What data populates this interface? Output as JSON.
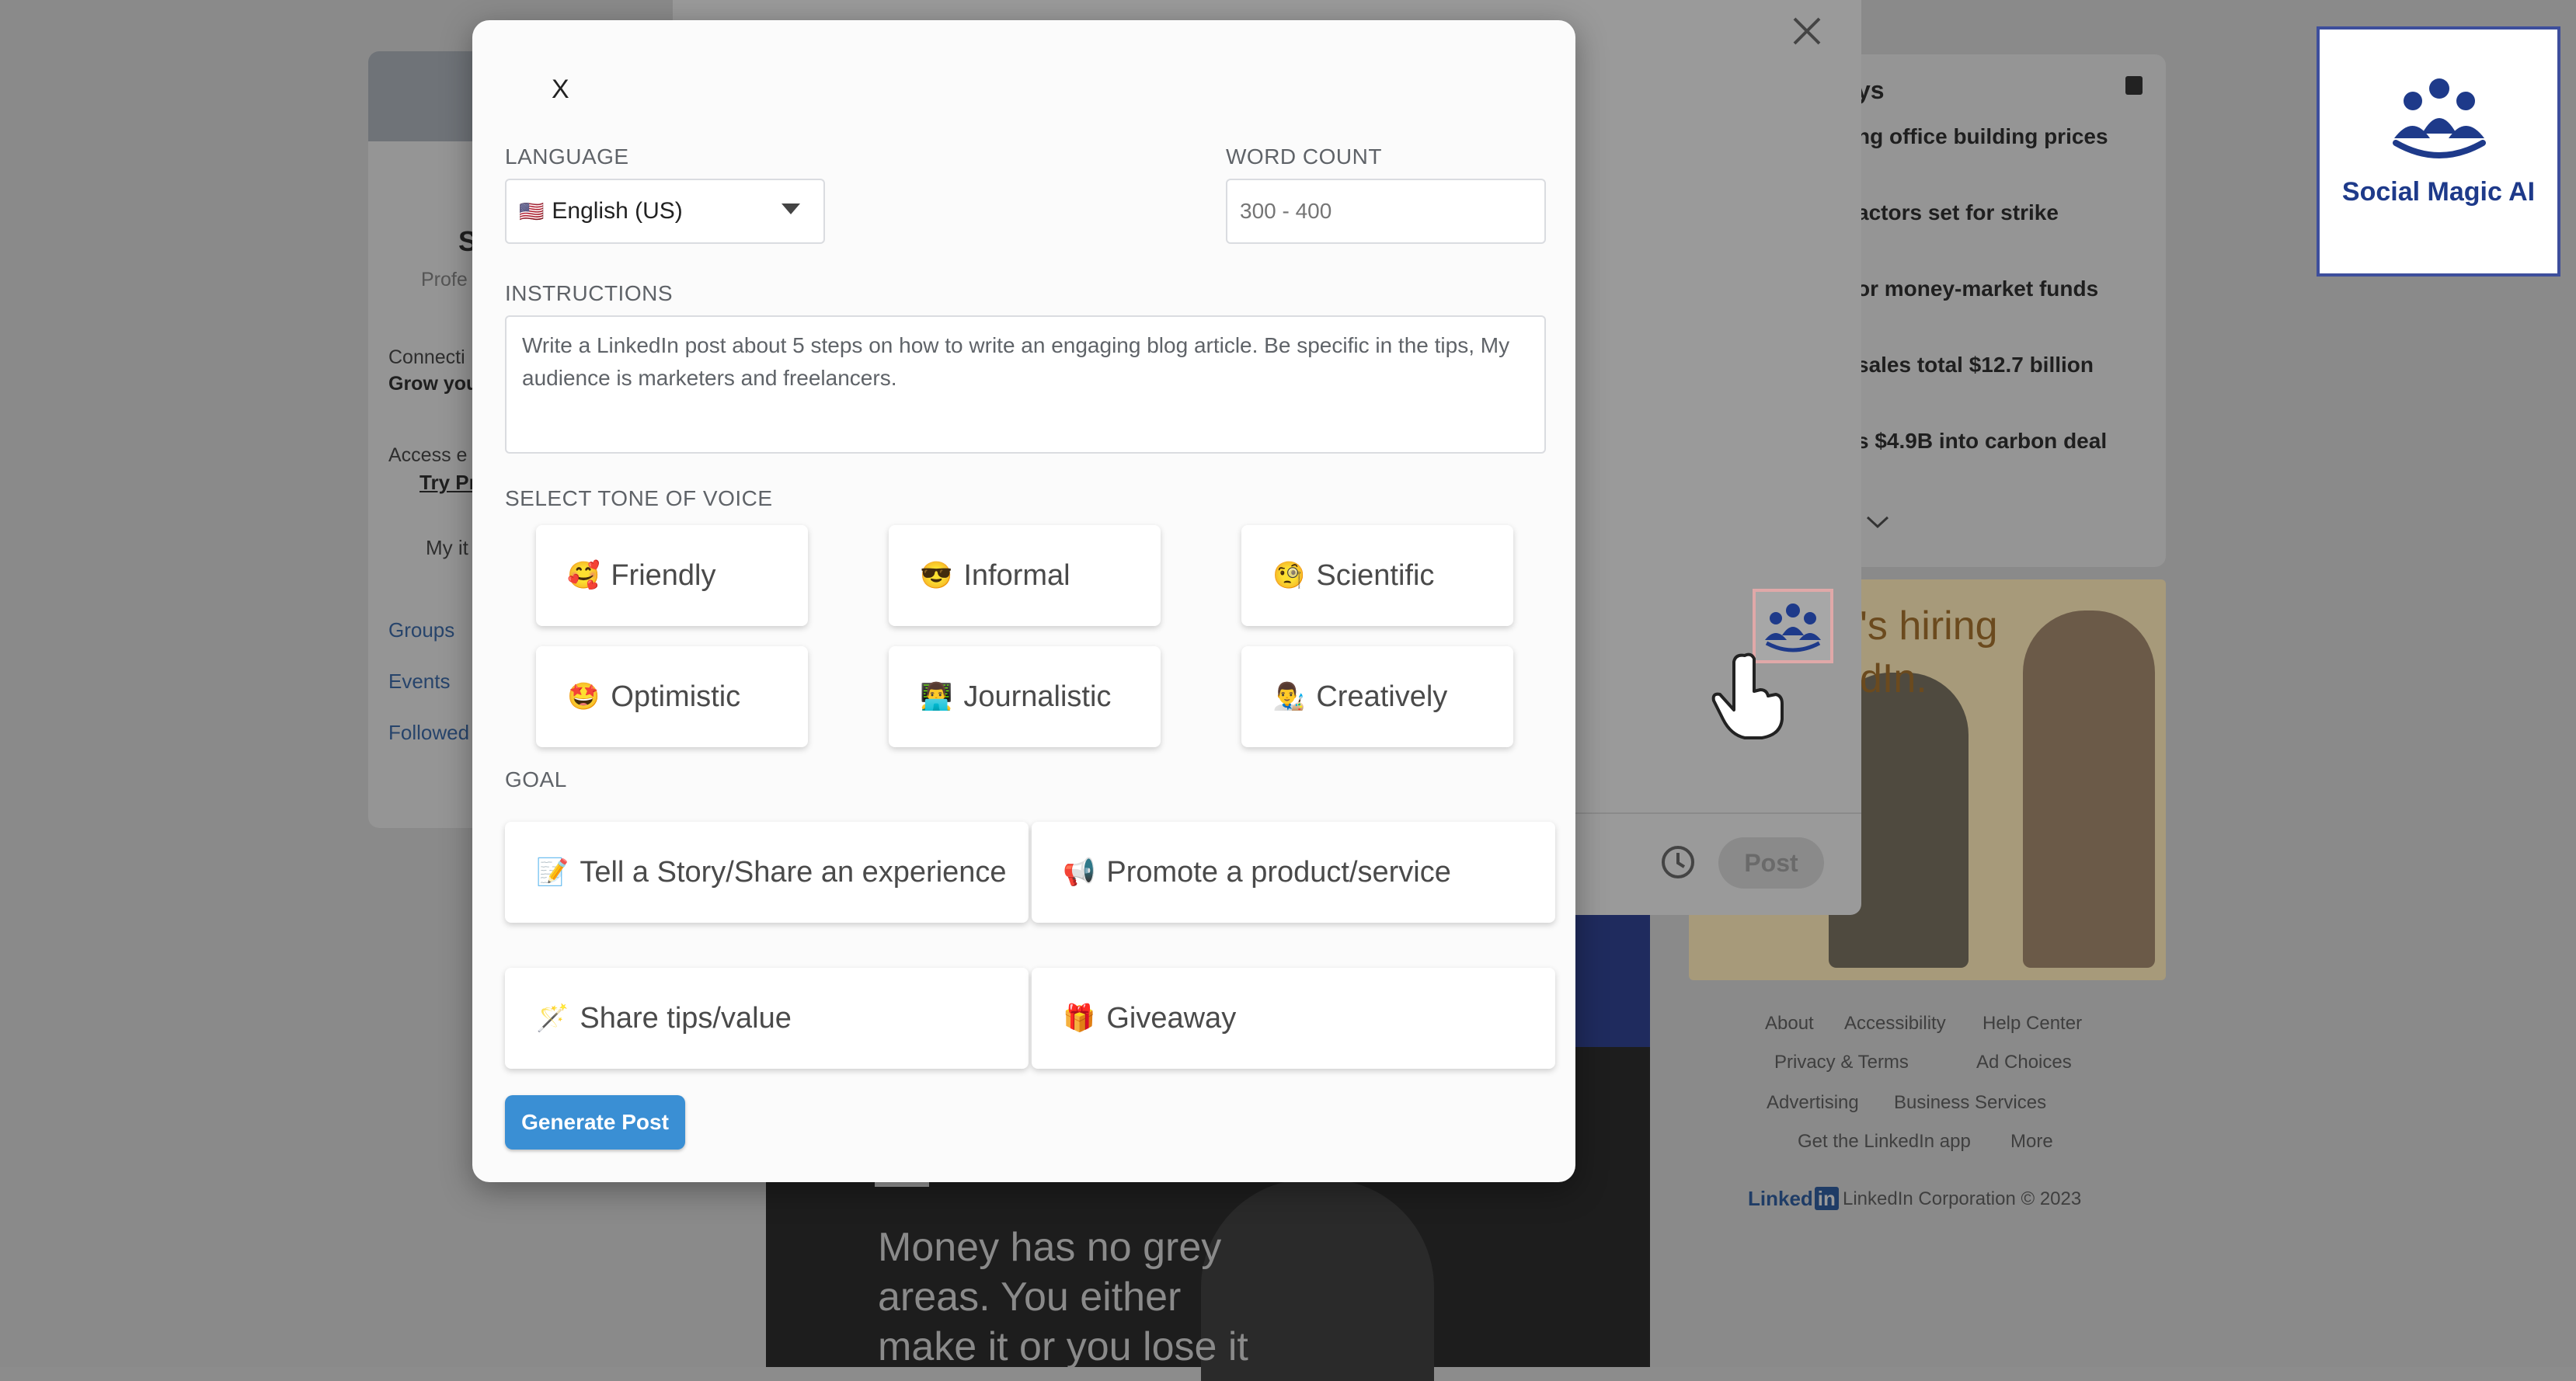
{
  "background": {
    "left": {
      "name_partial": "S",
      "headline_partial": "Profe",
      "connections_label": "Connecti",
      "connections_sub": "Grow you",
      "access_label": "Access e",
      "try_link": "Try Pr",
      "my_items": "My it",
      "links": [
        "Groups",
        "Events",
        "Followed"
      ]
    },
    "news": {
      "title_partial": "ys",
      "items": [
        "ng office building prices",
        "actors set for strike",
        "or money-market funds",
        "sales total $12.7 billion",
        "s $4.9B into carbon deal"
      ]
    },
    "ad": {
      "line1": "'s hiring",
      "line2": "dIn."
    },
    "footer": {
      "links_row1": [
        "About",
        "Accessibility",
        "Help Center"
      ],
      "links_row2": [
        "Privacy & Terms",
        "Ad Choices"
      ],
      "links_row3": [
        "Advertising",
        "Business Services"
      ],
      "links_row4": [
        "Get the LinkedIn app",
        "More"
      ],
      "brand": "Linked",
      "brand_in": "in",
      "copyright": "LinkedIn Corporation © 2023"
    },
    "post_quote": [
      "Money has no grey",
      "areas. You either",
      "make it or you lose it"
    ],
    "composer": {
      "post_label": "Post"
    }
  },
  "logo": {
    "text": "Social Magic AI"
  },
  "modal": {
    "close_label": "X",
    "language": {
      "label": "LANGUAGE",
      "flag": "🇺🇸",
      "value": "English (US)"
    },
    "word_count": {
      "label": "WORD COUNT",
      "placeholder": "300 - 400"
    },
    "instructions": {
      "label": "INSTRUCTIONS",
      "value": "Write a LinkedIn post about 5 steps on how to write an engaging blog article. Be specific in the tips, My audience is marketers and freelancers."
    },
    "tone": {
      "label": "SELECT TONE OF VOICE",
      "options": [
        {
          "emoji": "🥰",
          "label": "Friendly"
        },
        {
          "emoji": "😎",
          "label": "Informal"
        },
        {
          "emoji": "🧐",
          "label": "Scientific"
        },
        {
          "emoji": "🤩",
          "label": "Optimistic"
        },
        {
          "emoji": "👨‍💻",
          "label": "Journalistic"
        },
        {
          "emoji": "👨‍🎨",
          "label": "Creatively"
        }
      ]
    },
    "goal": {
      "label": "GOAL",
      "options": [
        {
          "emoji": "📝",
          "label": "Tell a Story/Share an experience"
        },
        {
          "emoji": "📢",
          "label": "Promote a product/service"
        },
        {
          "emoji": "🪄",
          "label": "Share tips/value"
        },
        {
          "emoji": "🎁",
          "label": "Giveaway"
        }
      ]
    },
    "generate_label": "Generate Post"
  },
  "colors": {
    "accent": "#3a8fd4",
    "logo_blue": "#1e3a8a",
    "overlay": "#8c8c8c"
  }
}
